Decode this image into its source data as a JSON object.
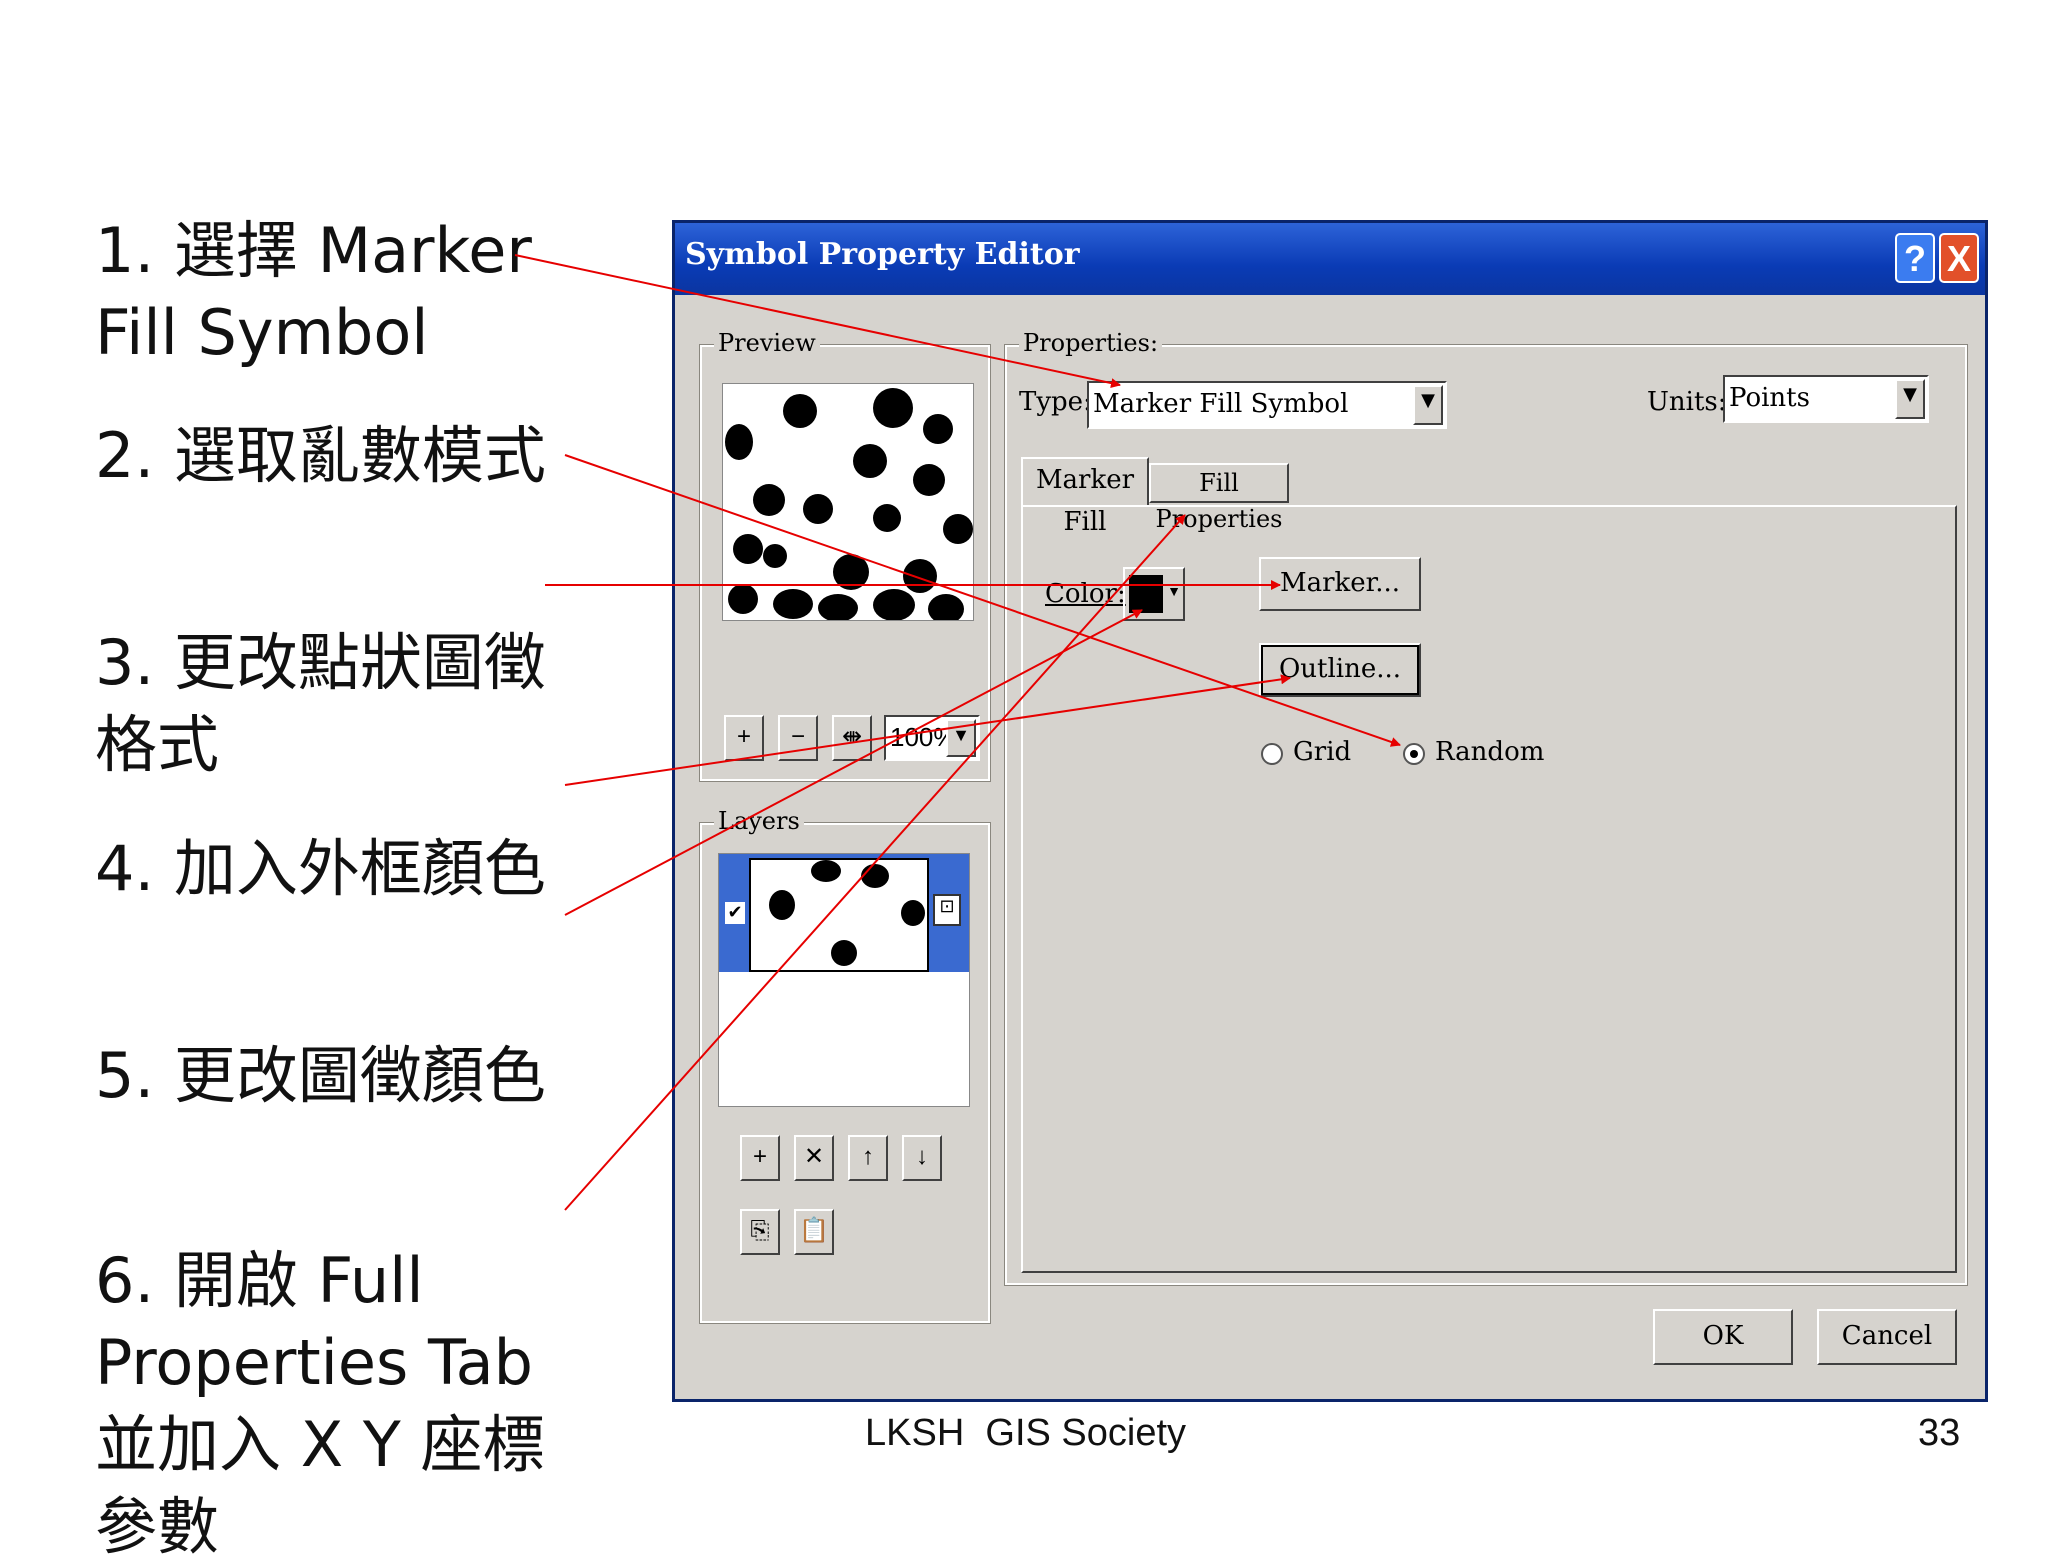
{
  "steps": [
    {
      "text": "1. 選擇 Marker Fill Symbol"
    },
    {
      "text": "2. 選取亂數模式"
    },
    {
      "text": "3. 更改點狀圖徵格式"
    },
    {
      "text": "4. 加入外框顏色"
    },
    {
      "text": "5. 更改圖徵顏色"
    },
    {
      "text": "6. 開啟 Full Properties Tab 並加入 X Y 座標參數"
    }
  ],
  "dialog": {
    "title": "Symbol Property Editor",
    "help_label": "?",
    "close_label": "X",
    "preview_label": "Preview",
    "zoom_value": "100%",
    "layers_label": "Layers",
    "properties_label": "Properties:",
    "type_label": "Type:",
    "type_value": "Marker Fill Symbol",
    "units_label": "Units:",
    "units_value": "Points",
    "tabs": [
      "Marker Fill",
      "Fill Properties"
    ],
    "color_label": "Color:",
    "marker_button": "Marker...",
    "outline_button": "Outline...",
    "grid_label": "Grid",
    "random_label": "Random",
    "ok_button": "OK",
    "cancel_button": "Cancel",
    "annotation_color": "#e60000"
  },
  "footer": {
    "society": "LKSH  GIS Society",
    "page": "33"
  }
}
